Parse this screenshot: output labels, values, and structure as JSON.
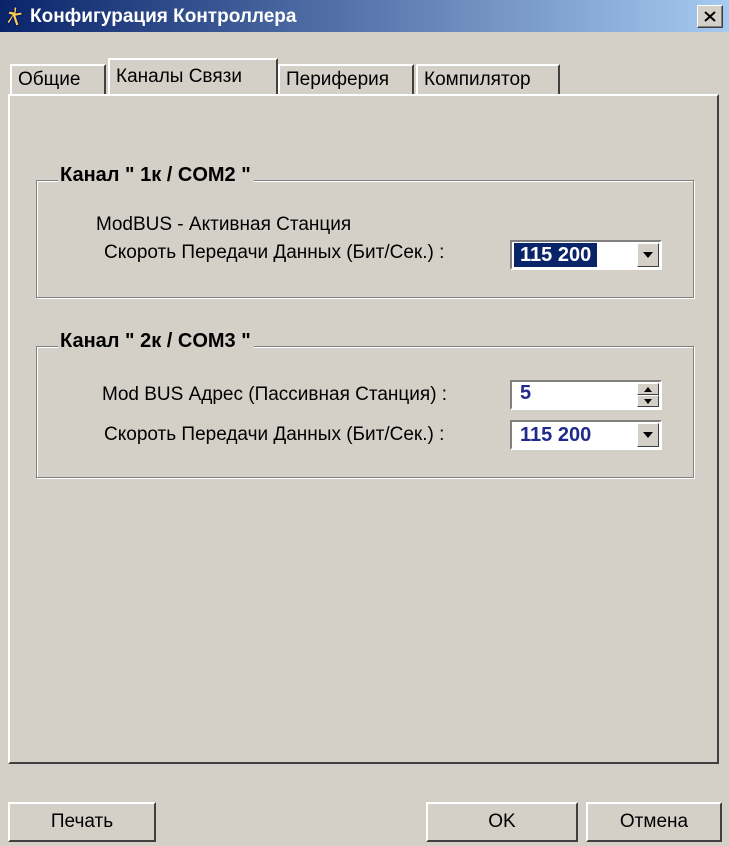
{
  "window": {
    "title": "Конфигурация Контроллера",
    "close_label": "×"
  },
  "tabs": [
    {
      "label": "Общие"
    },
    {
      "label": "Каналы Связи"
    },
    {
      "label": "Периферия"
    },
    {
      "label": "Компилятор"
    }
  ],
  "channel1": {
    "title": "Канал  \" 1к / COM2 \"",
    "mode_label": "ModBUS - Активная Станция",
    "speed_label": "Скороть Передачи Данных (Бит/Сек.) :",
    "speed_value": "115 200"
  },
  "channel2": {
    "title": "Канал \" 2к / COM3 \"",
    "address_label": "Mod BUS Адрес (Пассивная Станция) :",
    "address_value": "5",
    "speed_label": "Скороть Передачи Данных (Бит/Сек.) :",
    "speed_value": "115 200"
  },
  "buttons": {
    "print": "Печать",
    "ok": "OK",
    "cancel": "Отмена"
  }
}
